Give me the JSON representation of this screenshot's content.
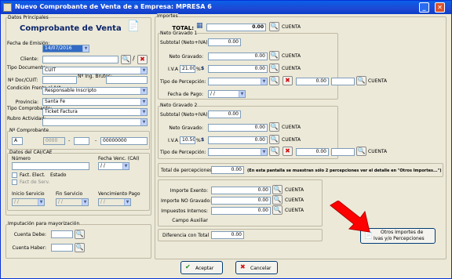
{
  "title": "Nuevo Comprobante de Venta de a Empresa: MPRESA 6",
  "icons": {
    "close": "✕",
    "minimize": "_",
    "search": "🔍",
    "del": "✖",
    "dd": "▼",
    "help": "?",
    "ok": "✔",
    "cancel": "✖",
    "docs": "📄"
  },
  "left": {
    "datos_principales": "Datos Principales",
    "header": "Comprobante de Venta",
    "fecha_label": "Fecha de Emisión:",
    "fecha_value": "14/07/2016",
    "cliente_label": "Cliente:",
    "tipo_doc_label": "Tipo Documento:",
    "tipo_doc_value": "CUIT",
    "ndoc_label": "Nº Doc/CUIT:",
    "ning_label": "Nº Ing. Brutos:",
    "iva_label": "Condición Frente al IVA:",
    "iva_value": "Responsable Inscripto",
    "provincia_label": "Provincia:",
    "provincia_value": "Santa Fe",
    "tipo_comp_label": "Tipo Comprobante:",
    "tipo_comp_value": "Ticket Factura",
    "rubro_label": "Rubro Actividad:",
    "ncomp_label": "Nº Comprobante",
    "letra": "A",
    "pv": "0000",
    "sep": "-",
    "num": "00000000",
    "cai_group": "Datos del CAI/CAE",
    "numero_label": "Número",
    "fecha_venc_label": "Fecha Venc. (CAI)",
    "fecha_venc_value": "/ /",
    "fact_elect": "Fact. Elect.",
    "estado_label": "Estado",
    "fact_serv": "Fact de Serv.",
    "inicio_label": "Inicio Servicio",
    "fin_label": "Fin Servicio",
    "venc_pago_label": "Vencimiento Pago",
    "empty_date": "/ /",
    "imput_group": "Imputación para mayorización",
    "cta_debe": "Cuenta Debe:",
    "cta_haber": "Cuenta Haber:"
  },
  "right": {
    "importes": "Importes",
    "total_label": "TOTAL:",
    "total_value": "0.00",
    "cuenta": "CUENTA",
    "ng1": "Neto Gravado 1",
    "subtotal_label": "Subtotal (Neto+IVA):",
    "subtotal1": "0.00",
    "neto_label": "Neto Gravado:",
    "neto1": "0.00",
    "iva_label": "I.V.A",
    "iva_rate1": "21.00",
    "pct": "%",
    "iva_amt1": "0.00",
    "tipo_perc_label": "Tipo de Percepción:",
    "perc1": "0.00",
    "fecha_pago_label": "Fecha de Pago:",
    "fecha_pago_value": "/ /",
    "ng2": "Neto Gravado 2",
    "subtotal2": "0.00",
    "neto2": "0.00",
    "iva_rate2": "10.50",
    "iva_amt2": "0.00",
    "perc2": "0.00",
    "total_perc_label": "Total de percepciones",
    "total_perc": "0.00",
    "perc_note": "(En esta pantalla se muestran sólo 2 percepciones ver el  detalle en \"Otros Importes...\")",
    "exento_label": "Importe Exento:",
    "exento": "0.00",
    "no_grav_label": "Importe NO Gravado:",
    "no_grav": "0.00",
    "imp_int_label": "Impuestos Internos:",
    "imp_int": "0.00",
    "campo_aux": "Campo Auxiliar",
    "dif_label": "Diferencia con Total",
    "dif": "0.00",
    "otros_btn_1": "Otros Importes de",
    "otros_btn_2": "Ivas y/o Percepciones"
  },
  "buttons": {
    "aceptar": "Aceptar",
    "cancelar": "Cancelar"
  },
  "colors": {
    "arrow": "#ff0000",
    "titlebar": "#0a5fe8"
  }
}
